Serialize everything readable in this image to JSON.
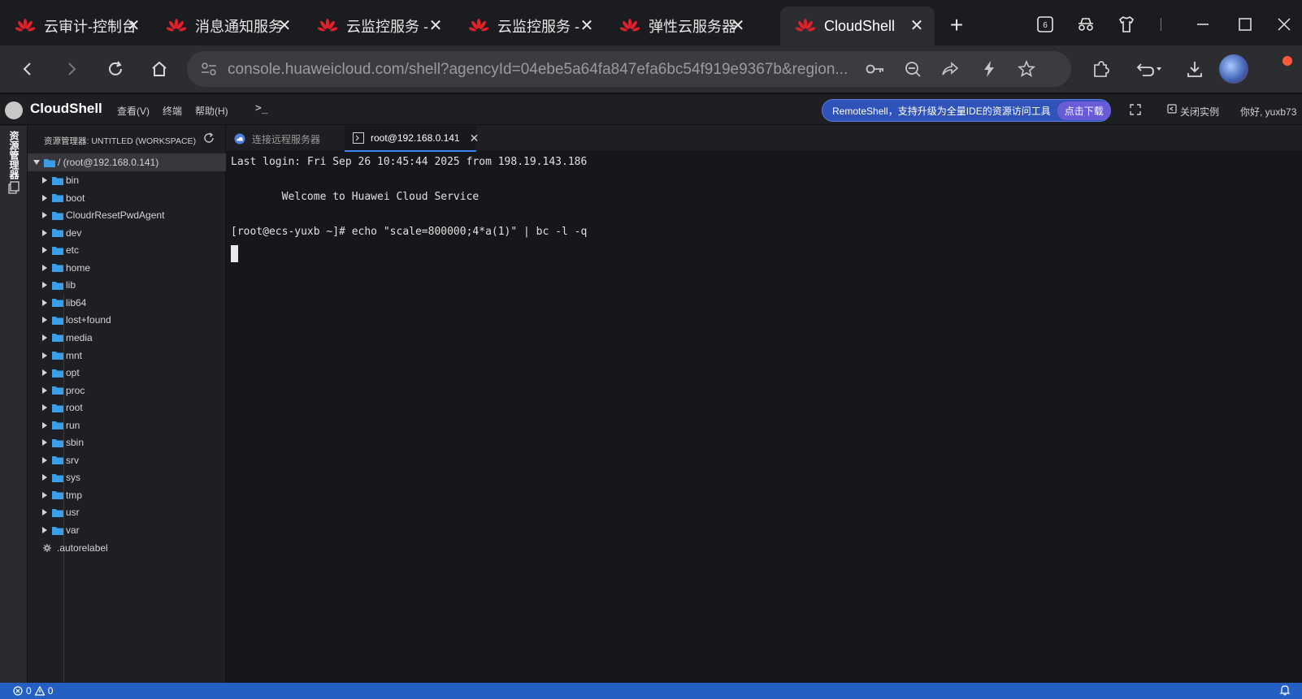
{
  "browser": {
    "tabs": [
      {
        "title": "云审计-控制台",
        "active": false
      },
      {
        "title": "消息通知服务",
        "active": false
      },
      {
        "title": "云监控服务 -",
        "active": false
      },
      {
        "title": "云监控服务 -",
        "active": false
      },
      {
        "title": "弹性云服务器",
        "active": false
      },
      {
        "title": "CloudShell",
        "active": true
      }
    ],
    "tab_close_glyph": "✕",
    "new_tab_glyph": "+",
    "tab_count_badge": "6",
    "url": "console.huaweicloud.com/shell?agencyId=04ebe5a64fa847efa6bc54f919e9367b&region..."
  },
  "app": {
    "name": "CloudShell",
    "menu": [
      "查看(V)",
      "终端",
      "帮助(H)"
    ],
    "promo_text": "RemoteShell，支持升级为全量IDE的资源访问工具",
    "promo_button": "点击下载",
    "close_instance": "关闭实例",
    "greeting": "你好, yuxb73"
  },
  "activity_bar": {
    "label": "资源管理器"
  },
  "explorer": {
    "title": "资源管理器: UNTITLED (WORKSPACE)",
    "root": "/ (root@192.168.0.141)",
    "folders": [
      "bin",
      "boot",
      "CloudrResetPwdAgent",
      "dev",
      "etc",
      "home",
      "lib",
      "lib64",
      "lost+found",
      "media",
      "mnt",
      "opt",
      "proc",
      "root",
      "run",
      "sbin",
      "srv",
      "sys",
      "tmp",
      "usr",
      "var"
    ],
    "files": [
      ".autorelabel"
    ]
  },
  "editor_tabs": [
    {
      "label": "连接远程服务器",
      "active": false
    },
    {
      "label": "root@192.168.0.141",
      "active": true
    }
  ],
  "terminal": {
    "lines": [
      "Last login: Fri Sep 26 10:45:44 2025 from 198.19.143.186",
      "",
      "        Welcome to Huawei Cloud Service",
      "",
      "[root@ecs-yuxb ~]# echo \"scale=800000;4*a(1)\" | bc -l -q"
    ]
  },
  "status_bar": {
    "errors": "0",
    "warnings": "0"
  },
  "colors": {
    "accent": "#2460c4",
    "promo_bg": "#2f53b8",
    "folder": "#3b9ee8",
    "huawei_red": "#e0202a"
  }
}
